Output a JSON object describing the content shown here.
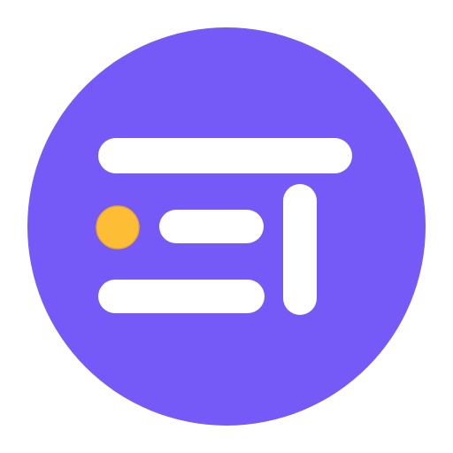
{
  "app_icon": {
    "icon_name": "app-logo-icon",
    "shape": "circle",
    "background_color": "#755AF7",
    "bar_color": "#FFFFFF",
    "dot_color": "#FDBE35",
    "dot_outline_color": "#E9A82B"
  }
}
